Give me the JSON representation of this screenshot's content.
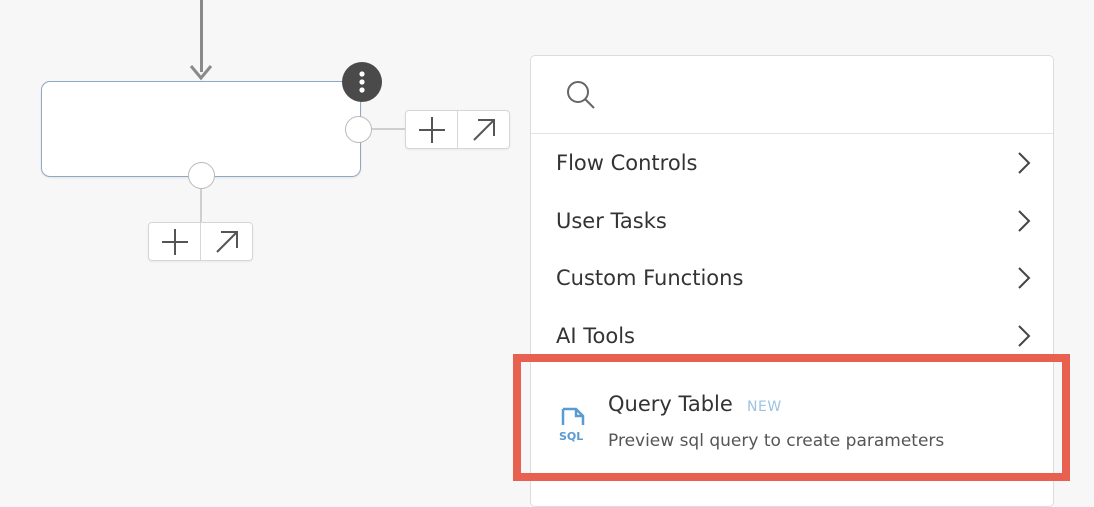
{
  "canvas": {
    "node": {
      "menu_icon": "more-vertical-icon"
    },
    "actions": {
      "add_icon": "plus-icon",
      "link_icon": "arrow-up-right-icon"
    }
  },
  "panel": {
    "search": {
      "placeholder": "",
      "icon": "search-icon"
    },
    "items": [
      {
        "label": "Flow Controls"
      },
      {
        "label": "User Tasks"
      },
      {
        "label": "Custom Functions"
      },
      {
        "label": "AI Tools"
      }
    ],
    "query_table": {
      "title": "Query Table",
      "badge": "NEW",
      "description": "Preview sql query to create parameters",
      "icon_text": "SQL",
      "icon": "sql-file-icon"
    }
  },
  "colors": {
    "highlight": "#e8604f",
    "badge": "#9ec3e0",
    "icon_blue": "#5a9bd1",
    "node_border": "#8fa8c4"
  }
}
